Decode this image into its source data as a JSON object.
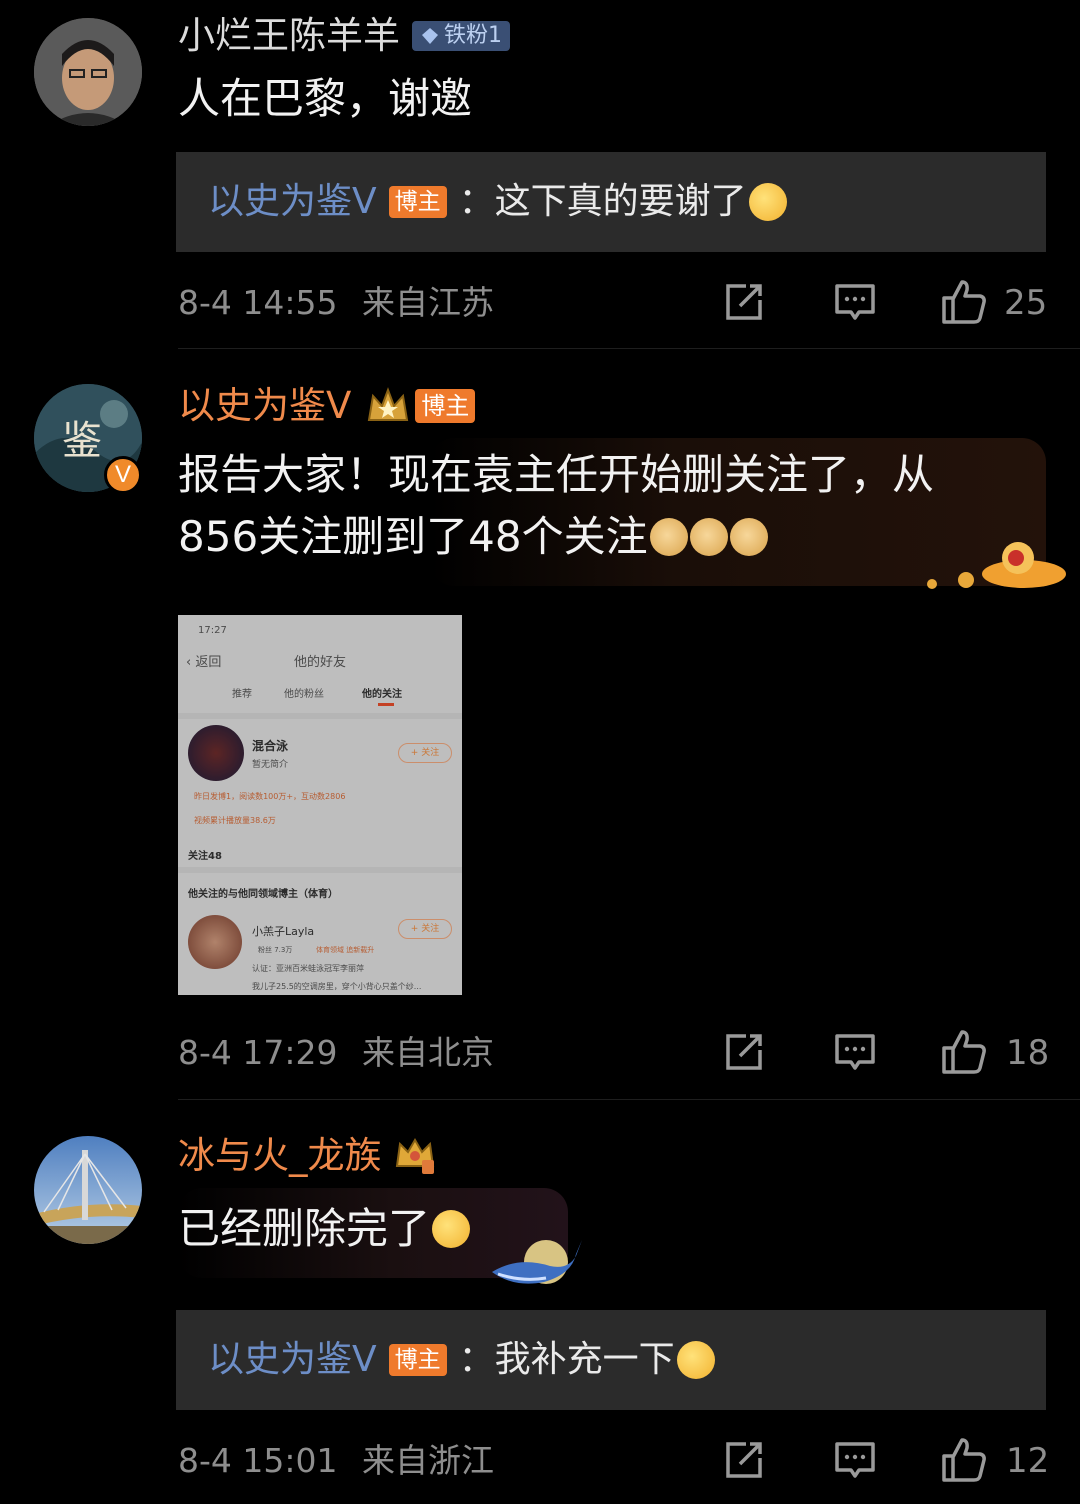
{
  "comments": [
    {
      "username": "小烂王陈羊羊",
      "badge": "铁粉1",
      "text": "人在巴黎，谢邀",
      "reply": {
        "user": "以史为鉴V",
        "tag": "博主",
        "sep": "：",
        "text": "这下真的要谢了"
      },
      "date": "8-4 14:55",
      "location": "来自江苏",
      "likes": "25"
    },
    {
      "username": "以史为鉴V",
      "tag": "博主",
      "text_line1": "报告大家！现在袁主任开始删关注了，从",
      "text_line2": "856关注删到了48个关注",
      "date": "8-4 17:29",
      "location": "来自北京",
      "likes": "18",
      "screenshot": {
        "time": "17:27",
        "back": "返回",
        "title": "他的好友",
        "tabs": [
          "推荐",
          "他的粉丝",
          "他的关注"
        ],
        "user1": {
          "name": "混合泳",
          "intro": "暂无简介",
          "follow": "+ 关注"
        },
        "stat1": "昨日发博1，阅读数100万+，互动数2806",
        "stat2": "视频累计播放量38.6万",
        "following": "关注48",
        "section": "他关注的与他同领域博主（体育）",
        "user2": {
          "name": "小羔子Layla",
          "fans": "粉丝 7.3万",
          "domain": "体育领域 追新载升",
          "auth": "认证：亚洲百米蛙泳冠军李丽萍",
          "desc": "我儿子25.5的空调房里，穿个小背心只盖个纱...",
          "follow": "+ 关注"
        }
      }
    },
    {
      "username": "冰与火_龙族",
      "text": "已经删除完了",
      "reply": {
        "user": "以史为鉴V",
        "tag": "博主",
        "sep": "：",
        "text": "我补充一下"
      },
      "date": "8-4 15:01",
      "location": "来自浙江",
      "likes": "12"
    }
  ],
  "icons": [
    "share-icon",
    "comment-icon",
    "like-icon"
  ],
  "colors": {
    "background": "#000000",
    "reply_user": "#6d8ec7",
    "vip_name": "#f08a4b",
    "tag_bg": "#ef7a2c",
    "meta": "#8e8e8e",
    "reply_bg": "#2b2b2b"
  }
}
